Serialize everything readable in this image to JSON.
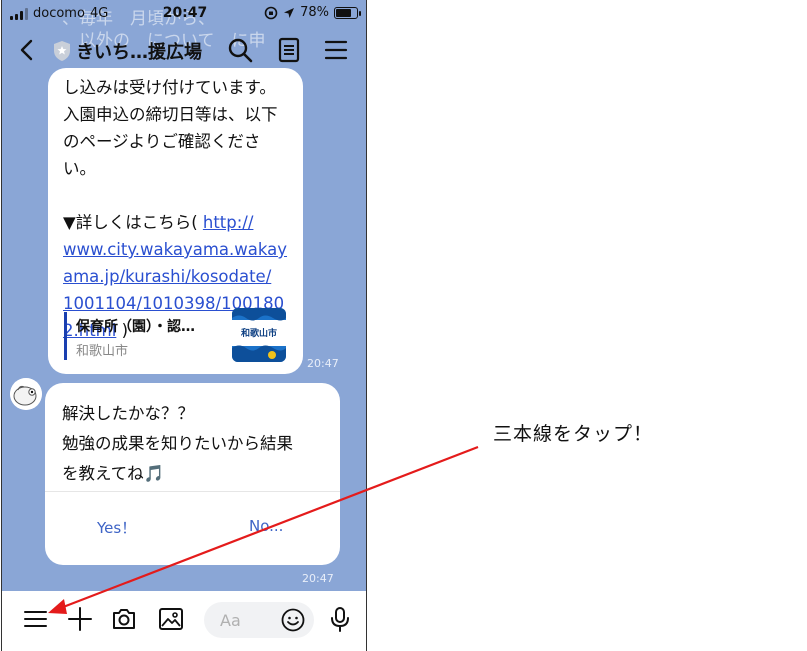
{
  "status_bar": {
    "carrier": "docomo",
    "network": "4G",
    "time": "20:47",
    "battery": "78%",
    "battery_level": 0.78
  },
  "ghost_text": [
    "、毎年　月頃から、",
    "　以外の　について　に申"
  ],
  "header": {
    "title": "きいち…援広場",
    "icons": [
      "chevron-left-icon",
      "shield-icon",
      "search-icon",
      "note-icon",
      "menu-icon"
    ]
  },
  "messages": [
    {
      "lines": [
        "し込みは受け付けています。",
        "入園申込の締切日等は、以下",
        "のページよりご確認くださ",
        "い。"
      ],
      "detail_prefix": "▼詳しくはこちら( ",
      "link_lines": [
        "http://",
        "www.city.wakayama.wakay",
        "ama.jp/kurashi/kosodate/",
        "1001104/1010398/100180",
        "2.html"
      ],
      "detail_suffix": " )",
      "preview": {
        "title": "保育所（園）・認…",
        "source": "和歌山市",
        "thumb_label": "和歌山市"
      },
      "time": "20:47"
    },
    {
      "lines": [
        "解決したかな？？",
        "勉強の成果を知りたいから結果",
        "を教えてね🎵"
      ],
      "buttons": [
        "Yes！",
        "No..."
      ],
      "time": "20:47"
    }
  ],
  "input": {
    "placeholder": "Aa"
  },
  "annotation": {
    "text": "三本線をタップ！",
    "arrow_color": "#e41b1b"
  },
  "colors": {
    "chat_background": "#8aa6d6",
    "link": "#2a4fd0",
    "button_text": "#3e64c6"
  }
}
